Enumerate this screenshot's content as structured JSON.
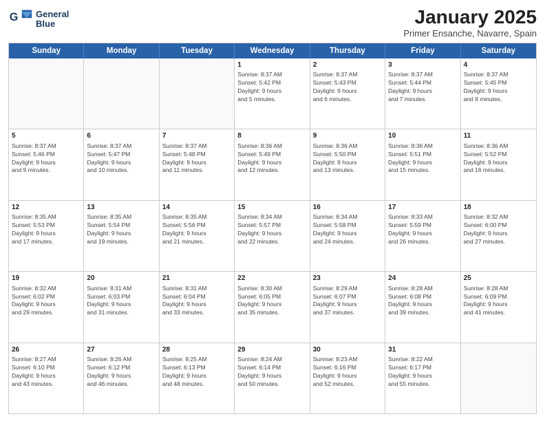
{
  "logo": {
    "line1": "General",
    "line2": "Blue"
  },
  "title": "January 2025",
  "subtitle": "Primer Ensanche, Navarre, Spain",
  "header_days": [
    "Sunday",
    "Monday",
    "Tuesday",
    "Wednesday",
    "Thursday",
    "Friday",
    "Saturday"
  ],
  "weeks": [
    [
      {
        "day": "",
        "text": ""
      },
      {
        "day": "",
        "text": ""
      },
      {
        "day": "",
        "text": ""
      },
      {
        "day": "1",
        "text": "Sunrise: 8:37 AM\nSunset: 5:42 PM\nDaylight: 9 hours\nand 5 minutes."
      },
      {
        "day": "2",
        "text": "Sunrise: 8:37 AM\nSunset: 5:43 PM\nDaylight: 9 hours\nand 6 minutes."
      },
      {
        "day": "3",
        "text": "Sunrise: 8:37 AM\nSunset: 5:44 PM\nDaylight: 9 hours\nand 7 minutes."
      },
      {
        "day": "4",
        "text": "Sunrise: 8:37 AM\nSunset: 5:45 PM\nDaylight: 9 hours\nand 8 minutes."
      }
    ],
    [
      {
        "day": "5",
        "text": "Sunrise: 8:37 AM\nSunset: 5:46 PM\nDaylight: 9 hours\nand 9 minutes."
      },
      {
        "day": "6",
        "text": "Sunrise: 8:37 AM\nSunset: 5:47 PM\nDaylight: 9 hours\nand 10 minutes."
      },
      {
        "day": "7",
        "text": "Sunrise: 8:37 AM\nSunset: 5:48 PM\nDaylight: 9 hours\nand 11 minutes."
      },
      {
        "day": "8",
        "text": "Sunrise: 8:36 AM\nSunset: 5:49 PM\nDaylight: 9 hours\nand 12 minutes."
      },
      {
        "day": "9",
        "text": "Sunrise: 8:36 AM\nSunset: 5:50 PM\nDaylight: 9 hours\nand 13 minutes."
      },
      {
        "day": "10",
        "text": "Sunrise: 8:36 AM\nSunset: 5:51 PM\nDaylight: 9 hours\nand 15 minutes."
      },
      {
        "day": "11",
        "text": "Sunrise: 8:36 AM\nSunset: 5:52 PM\nDaylight: 9 hours\nand 16 minutes."
      }
    ],
    [
      {
        "day": "12",
        "text": "Sunrise: 8:35 AM\nSunset: 5:53 PM\nDaylight: 9 hours\nand 17 minutes."
      },
      {
        "day": "13",
        "text": "Sunrise: 8:35 AM\nSunset: 5:54 PM\nDaylight: 9 hours\nand 19 minutes."
      },
      {
        "day": "14",
        "text": "Sunrise: 8:35 AM\nSunset: 5:56 PM\nDaylight: 9 hours\nand 21 minutes."
      },
      {
        "day": "15",
        "text": "Sunrise: 8:34 AM\nSunset: 5:57 PM\nDaylight: 9 hours\nand 22 minutes."
      },
      {
        "day": "16",
        "text": "Sunrise: 8:34 AM\nSunset: 5:58 PM\nDaylight: 9 hours\nand 24 minutes."
      },
      {
        "day": "17",
        "text": "Sunrise: 8:33 AM\nSunset: 5:59 PM\nDaylight: 9 hours\nand 26 minutes."
      },
      {
        "day": "18",
        "text": "Sunrise: 8:32 AM\nSunset: 6:00 PM\nDaylight: 9 hours\nand 27 minutes."
      }
    ],
    [
      {
        "day": "19",
        "text": "Sunrise: 8:32 AM\nSunset: 6:02 PM\nDaylight: 9 hours\nand 29 minutes."
      },
      {
        "day": "20",
        "text": "Sunrise: 8:31 AM\nSunset: 6:03 PM\nDaylight: 9 hours\nand 31 minutes."
      },
      {
        "day": "21",
        "text": "Sunrise: 8:31 AM\nSunset: 6:04 PM\nDaylight: 9 hours\nand 33 minutes."
      },
      {
        "day": "22",
        "text": "Sunrise: 8:30 AM\nSunset: 6:05 PM\nDaylight: 9 hours\nand 35 minutes."
      },
      {
        "day": "23",
        "text": "Sunrise: 8:29 AM\nSunset: 6:07 PM\nDaylight: 9 hours\nand 37 minutes."
      },
      {
        "day": "24",
        "text": "Sunrise: 8:28 AM\nSunset: 6:08 PM\nDaylight: 9 hours\nand 39 minutes."
      },
      {
        "day": "25",
        "text": "Sunrise: 8:28 AM\nSunset: 6:09 PM\nDaylight: 9 hours\nand 41 minutes."
      }
    ],
    [
      {
        "day": "26",
        "text": "Sunrise: 8:27 AM\nSunset: 6:10 PM\nDaylight: 9 hours\nand 43 minutes."
      },
      {
        "day": "27",
        "text": "Sunrise: 8:26 AM\nSunset: 6:12 PM\nDaylight: 9 hours\nand 46 minutes."
      },
      {
        "day": "28",
        "text": "Sunrise: 8:25 AM\nSunset: 6:13 PM\nDaylight: 9 hours\nand 48 minutes."
      },
      {
        "day": "29",
        "text": "Sunrise: 8:24 AM\nSunset: 6:14 PM\nDaylight: 9 hours\nand 50 minutes."
      },
      {
        "day": "30",
        "text": "Sunrise: 8:23 AM\nSunset: 6:16 PM\nDaylight: 9 hours\nand 52 minutes."
      },
      {
        "day": "31",
        "text": "Sunrise: 8:22 AM\nSunset: 6:17 PM\nDaylight: 9 hours\nand 55 minutes."
      },
      {
        "day": "",
        "text": ""
      }
    ]
  ]
}
